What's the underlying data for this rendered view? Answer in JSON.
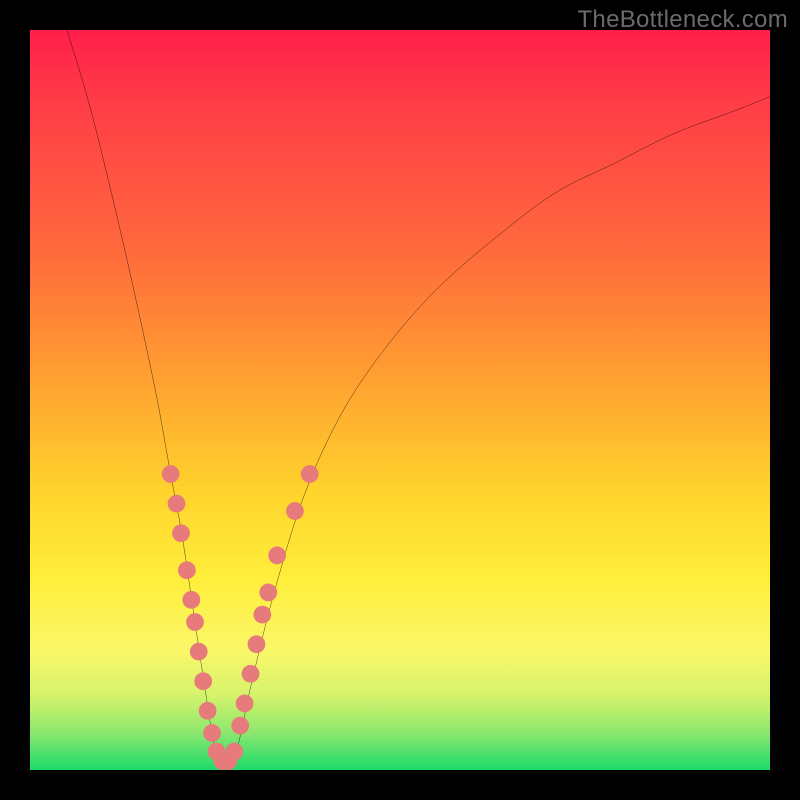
{
  "watermark": "TheBottleneck.com",
  "chart_data": {
    "type": "line",
    "title": "",
    "xlabel": "",
    "ylabel": "",
    "xlim": [
      0,
      100
    ],
    "ylim": [
      0,
      100
    ],
    "grid": false,
    "series": [
      {
        "name": "bottleneck-curve",
        "color": "#000000",
        "x": [
          5,
          8,
          11,
          14,
          17,
          19,
          20.5,
          22,
          23.5,
          25,
          26.5,
          28,
          30,
          33,
          37,
          42,
          48,
          55,
          63,
          71,
          79,
          87,
          95,
          100
        ],
        "y": [
          100,
          90,
          78,
          65,
          51,
          40,
          32,
          22,
          12,
          3,
          1,
          3,
          12,
          24,
          37,
          48,
          57,
          65,
          72,
          78,
          82,
          86,
          89,
          91
        ]
      }
    ],
    "dots": {
      "name": "highlight-dots",
      "color": "#e77a7a",
      "radius": 1.2,
      "points": [
        {
          "x": 19.0,
          "y": 40
        },
        {
          "x": 19.8,
          "y": 36
        },
        {
          "x": 20.4,
          "y": 32
        },
        {
          "x": 21.2,
          "y": 27
        },
        {
          "x": 21.8,
          "y": 23
        },
        {
          "x": 22.3,
          "y": 20
        },
        {
          "x": 22.8,
          "y": 16
        },
        {
          "x": 23.4,
          "y": 12
        },
        {
          "x": 24.0,
          "y": 8
        },
        {
          "x": 24.6,
          "y": 5
        },
        {
          "x": 25.2,
          "y": 2.5
        },
        {
          "x": 26.0,
          "y": 1.2
        },
        {
          "x": 26.8,
          "y": 1.2
        },
        {
          "x": 27.6,
          "y": 2.5
        },
        {
          "x": 28.4,
          "y": 6
        },
        {
          "x": 29.0,
          "y": 9
        },
        {
          "x": 29.8,
          "y": 13
        },
        {
          "x": 30.6,
          "y": 17
        },
        {
          "x": 31.4,
          "y": 21
        },
        {
          "x": 32.2,
          "y": 24
        },
        {
          "x": 33.4,
          "y": 29
        },
        {
          "x": 35.8,
          "y": 35
        },
        {
          "x": 37.8,
          "y": 40
        }
      ]
    }
  }
}
